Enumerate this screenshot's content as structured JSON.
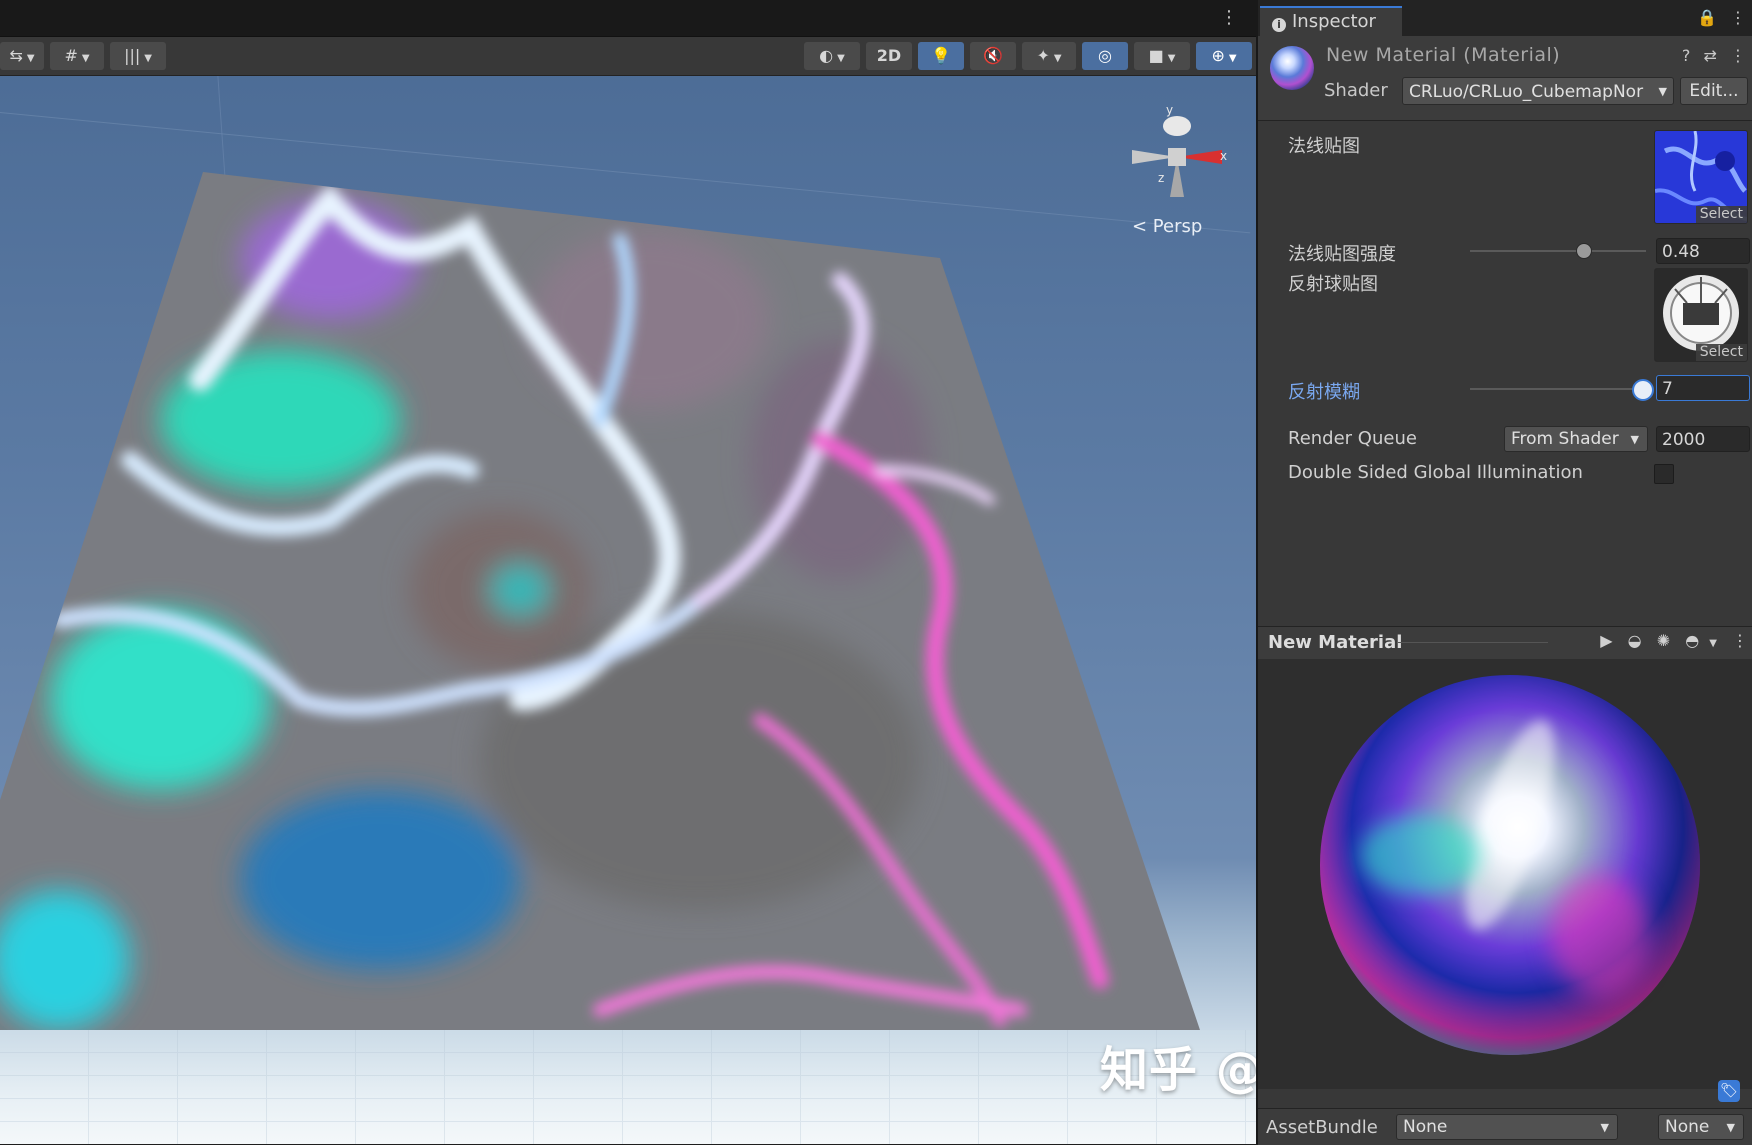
{
  "scene": {
    "toolbar": {
      "dropdown_arrow": "▼",
      "two_d_label": "2D"
    },
    "gizmo": {
      "axis_y": "y",
      "axis_x": "x",
      "axis_z": "z"
    },
    "view_label": "< Persp"
  },
  "watermark": "知乎 @CRomputer罗老师",
  "inspector": {
    "tab_label": "Inspector",
    "material_title": "New Material (Material)",
    "shader_label": "Shader",
    "shader_value": "CRLuo/CRLuo_CubemapNor",
    "edit_label": "Edit...",
    "properties": {
      "normal_map_label": "法线贴图",
      "normal_map_select": "Select",
      "normal_strength_label": "法线贴图强度",
      "normal_strength_value": "0.48",
      "reflection_map_label": "反射球贴图",
      "reflection_map_select": "Select",
      "reflection_blur_label": "反射模糊",
      "reflection_blur_value": "7",
      "render_queue_label": "Render Queue",
      "render_queue_mode": "From Shader",
      "render_queue_value": "2000",
      "double_sided_gi_label": "Double Sided Global Illumination"
    },
    "preview_title": "New Material",
    "asset_bundle_label": "AssetBundle",
    "asset_bundle_name": "None",
    "asset_bundle_variant": "None"
  },
  "colors": {
    "accent": "#3a7ad6",
    "panel_bg": "#383838",
    "highlight_label": "#7aa8f0"
  }
}
